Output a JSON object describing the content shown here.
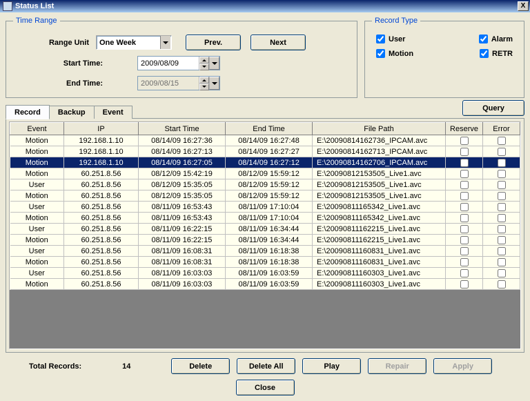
{
  "window": {
    "title": "Status List",
    "close": "X"
  },
  "time_range": {
    "legend": "Time Range",
    "range_unit_label": "Range Unit",
    "range_unit_value": "One Week",
    "prev": "Prev.",
    "next": "Next",
    "start_time_label": "Start Time:",
    "start_time_value": "2009/08/09",
    "end_time_label": "End Time:",
    "end_time_value": "2009/08/15"
  },
  "record_type": {
    "legend": "Record Type",
    "user": "User",
    "alarm": "Alarm",
    "motion": "Motion",
    "retr": "RETR"
  },
  "tabs": {
    "record": "Record",
    "backup": "Backup",
    "event": "Event",
    "query": "Query"
  },
  "columns": {
    "event": "Event",
    "ip": "IP",
    "start": "Start Time",
    "end": "End Time",
    "path": "File Path",
    "reserve": "Reserve",
    "error": "Error"
  },
  "rows": [
    {
      "event": "Motion",
      "ip": "192.168.1.10",
      "start": "08/14/09 16:27:36",
      "end": "08/14/09 16:27:48",
      "path": "E:\\20090814162736_IPCAM.avc",
      "sel": false
    },
    {
      "event": "Motion",
      "ip": "192.168.1.10",
      "start": "08/14/09 16:27:13",
      "end": "08/14/09 16:27:27",
      "path": "E:\\20090814162713_IPCAM.avc",
      "sel": false
    },
    {
      "event": "Motion",
      "ip": "192.168.1.10",
      "start": "08/14/09 16:27:05",
      "end": "08/14/09 16:27:12",
      "path": "E:\\20090814162706_IPCAM.avc",
      "sel": true
    },
    {
      "event": "Motion",
      "ip": "60.251.8.56",
      "start": "08/12/09 15:42:19",
      "end": "08/12/09 15:59:12",
      "path": "E:\\20090812153505_Live1.avc",
      "sel": false
    },
    {
      "event": "User",
      "ip": "60.251.8.56",
      "start": "08/12/09 15:35:05",
      "end": "08/12/09 15:59:12",
      "path": "E:\\20090812153505_Live1.avc",
      "sel": false
    },
    {
      "event": "Motion",
      "ip": "60.251.8.56",
      "start": "08/12/09 15:35:05",
      "end": "08/12/09 15:59:12",
      "path": "E:\\20090812153505_Live1.avc",
      "sel": false
    },
    {
      "event": "User",
      "ip": "60.251.8.56",
      "start": "08/11/09 16:53:43",
      "end": "08/11/09 17:10:04",
      "path": "E:\\20090811165342_Live1.avc",
      "sel": false
    },
    {
      "event": "Motion",
      "ip": "60.251.8.56",
      "start": "08/11/09 16:53:43",
      "end": "08/11/09 17:10:04",
      "path": "E:\\20090811165342_Live1.avc",
      "sel": false
    },
    {
      "event": "User",
      "ip": "60.251.8.56",
      "start": "08/11/09 16:22:15",
      "end": "08/11/09 16:34:44",
      "path": "E:\\20090811162215_Live1.avc",
      "sel": false
    },
    {
      "event": "Motion",
      "ip": "60.251.8.56",
      "start": "08/11/09 16:22:15",
      "end": "08/11/09 16:34:44",
      "path": "E:\\20090811162215_Live1.avc",
      "sel": false
    },
    {
      "event": "User",
      "ip": "60.251.8.56",
      "start": "08/11/09 16:08:31",
      "end": "08/11/09 16:18:38",
      "path": "E:\\20090811160831_Live1.avc",
      "sel": false
    },
    {
      "event": "Motion",
      "ip": "60.251.8.56",
      "start": "08/11/09 16:08:31",
      "end": "08/11/09 16:18:38",
      "path": "E:\\20090811160831_Live1.avc",
      "sel": false
    },
    {
      "event": "User",
      "ip": "60.251.8.56",
      "start": "08/11/09 16:03:03",
      "end": "08/11/09 16:03:59",
      "path": "E:\\20090811160303_Live1.avc",
      "sel": false
    },
    {
      "event": "Motion",
      "ip": "60.251.8.56",
      "start": "08/11/09 16:03:03",
      "end": "08/11/09 16:03:59",
      "path": "E:\\20090811160303_Live1.avc",
      "sel": false
    }
  ],
  "footer": {
    "total_label": "Total Records:",
    "total_value": "14",
    "delete": "Delete",
    "delete_all": "Delete All",
    "play": "Play",
    "repair": "Repair",
    "apply": "Apply",
    "close": "Close"
  }
}
